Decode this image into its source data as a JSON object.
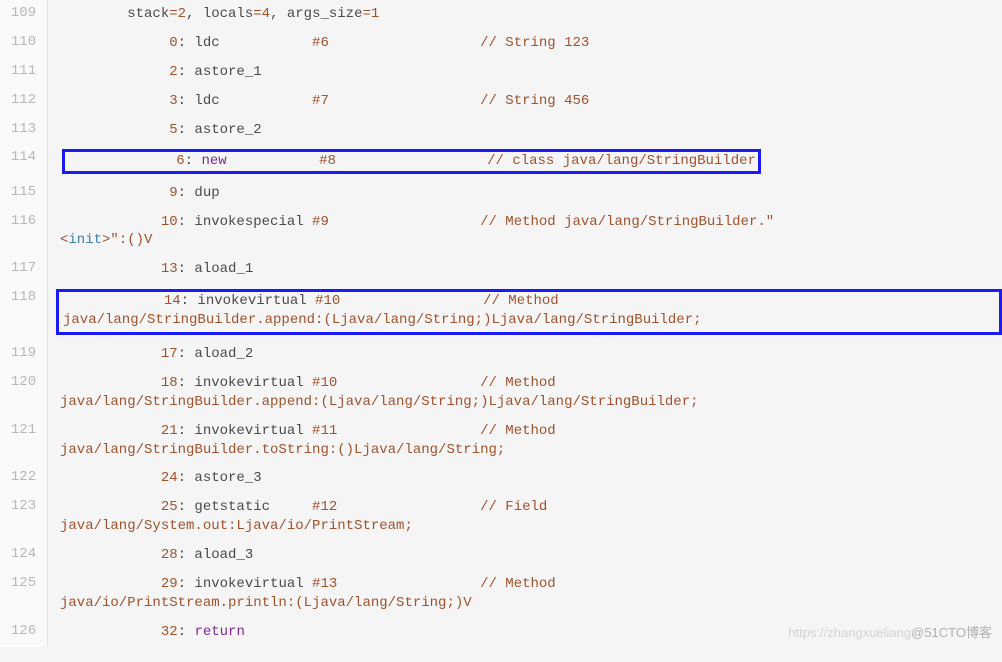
{
  "watermark": {
    "faint": "https://zhangxueliang",
    "dark": "@51CTO博客"
  },
  "lines": [
    {
      "ln": "109",
      "segs": [
        {
          "t": "        stack",
          "c": "c-dark"
        },
        {
          "t": "=",
          "c": "c-orange"
        },
        {
          "t": "2",
          "c": "c-orange"
        },
        {
          "t": ", locals",
          "c": "c-dark"
        },
        {
          "t": "=",
          "c": "c-orange"
        },
        {
          "t": "4",
          "c": "c-orange"
        },
        {
          "t": ", args_size",
          "c": "c-dark"
        },
        {
          "t": "=",
          "c": "c-orange"
        },
        {
          "t": "1",
          "c": "c-orange"
        }
      ]
    },
    {
      "ln": "110",
      "segs": [
        {
          "t": "             0",
          "c": "c-orange"
        },
        {
          "t": ": ldc           ",
          "c": "c-dark"
        },
        {
          "t": "#6",
          "c": "c-orange"
        },
        {
          "t": "                  ",
          "c": "c-dark"
        },
        {
          "t": "// String 123",
          "c": "c-orange"
        }
      ]
    },
    {
      "ln": "111",
      "segs": [
        {
          "t": "             2",
          "c": "c-orange"
        },
        {
          "t": ": astore_1",
          "c": "c-dark"
        }
      ]
    },
    {
      "ln": "112",
      "segs": [
        {
          "t": "             3",
          "c": "c-orange"
        },
        {
          "t": ": ldc           ",
          "c": "c-dark"
        },
        {
          "t": "#7",
          "c": "c-orange"
        },
        {
          "t": "                  ",
          "c": "c-dark"
        },
        {
          "t": "// String 456",
          "c": "c-orange"
        }
      ]
    },
    {
      "ln": "113",
      "segs": [
        {
          "t": "             5",
          "c": "c-orange"
        },
        {
          "t": ": astore_2",
          "c": "c-dark"
        }
      ]
    },
    {
      "ln": "114",
      "hl": "inline",
      "segs": [
        {
          "t": "             6",
          "c": "c-orange"
        },
        {
          "t": ": ",
          "c": "c-dark"
        },
        {
          "t": "new",
          "c": "c-purple"
        },
        {
          "t": "           ",
          "c": "c-dark"
        },
        {
          "t": "#8",
          "c": "c-orange"
        },
        {
          "t": "                  ",
          "c": "c-dark"
        },
        {
          "t": "// class java/lang/StringBuilder",
          "c": "c-orange"
        }
      ]
    },
    {
      "ln": "115",
      "segs": [
        {
          "t": "             9",
          "c": "c-orange"
        },
        {
          "t": ": dup",
          "c": "c-dark"
        }
      ]
    },
    {
      "ln": "116",
      "segs": [
        {
          "t": "            10",
          "c": "c-orange"
        },
        {
          "t": ": invokespecial ",
          "c": "c-dark"
        },
        {
          "t": "#9",
          "c": "c-orange"
        },
        {
          "t": "                  ",
          "c": "c-dark"
        },
        {
          "t": "// Method java/lang/StringBuilder.\"",
          "c": "c-orange"
        }
      ],
      "wrap": [
        {
          "t": "<",
          "c": "c-orange"
        },
        {
          "t": "init",
          "c": "c-blue"
        },
        {
          "t": ">\":()V",
          "c": "c-orange"
        }
      ]
    },
    {
      "ln": "117",
      "segs": [
        {
          "t": "            13",
          "c": "c-orange"
        },
        {
          "t": ": aload_1",
          "c": "c-dark"
        }
      ]
    },
    {
      "ln": "118",
      "hl": "block",
      "segs": [
        {
          "t": "            14",
          "c": "c-orange"
        },
        {
          "t": ": invokevirtual ",
          "c": "c-dark"
        },
        {
          "t": "#10",
          "c": "c-orange"
        },
        {
          "t": "                 ",
          "c": "c-dark"
        },
        {
          "t": "// Method ",
          "c": "c-orange"
        }
      ],
      "wrap": [
        {
          "t": "java/lang/StringBuilder.append:(Ljava/lang/String;)Ljava/lang/StringBuilder;",
          "c": "c-orange"
        }
      ]
    },
    {
      "ln": "119",
      "segs": [
        {
          "t": "            17",
          "c": "c-orange"
        },
        {
          "t": ": aload_2",
          "c": "c-dark"
        }
      ]
    },
    {
      "ln": "120",
      "segs": [
        {
          "t": "            18",
          "c": "c-orange"
        },
        {
          "t": ": invokevirtual ",
          "c": "c-dark"
        },
        {
          "t": "#10",
          "c": "c-orange"
        },
        {
          "t": "                 ",
          "c": "c-dark"
        },
        {
          "t": "// Method ",
          "c": "c-orange"
        }
      ],
      "wrap": [
        {
          "t": "java/lang/StringBuilder.append:(Ljava/lang/String;)Ljava/lang/StringBuilder;",
          "c": "c-orange"
        }
      ]
    },
    {
      "ln": "121",
      "segs": [
        {
          "t": "            21",
          "c": "c-orange"
        },
        {
          "t": ": invokevirtual ",
          "c": "c-dark"
        },
        {
          "t": "#11",
          "c": "c-orange"
        },
        {
          "t": "                 ",
          "c": "c-dark"
        },
        {
          "t": "// Method ",
          "c": "c-orange"
        }
      ],
      "wrap": [
        {
          "t": "java/lang/StringBuilder.toString:()Ljava/lang/String;",
          "c": "c-orange"
        }
      ]
    },
    {
      "ln": "122",
      "segs": [
        {
          "t": "            24",
          "c": "c-orange"
        },
        {
          "t": ": astore_3",
          "c": "c-dark"
        }
      ]
    },
    {
      "ln": "123",
      "segs": [
        {
          "t": "            25",
          "c": "c-orange"
        },
        {
          "t": ": getstatic     ",
          "c": "c-dark"
        },
        {
          "t": "#12",
          "c": "c-orange"
        },
        {
          "t": "                 ",
          "c": "c-dark"
        },
        {
          "t": "// Field ",
          "c": "c-orange"
        }
      ],
      "wrap": [
        {
          "t": "java/lang/System.out:Ljava/io/PrintStream;",
          "c": "c-orange"
        }
      ]
    },
    {
      "ln": "124",
      "segs": [
        {
          "t": "            28",
          "c": "c-orange"
        },
        {
          "t": ": aload_3",
          "c": "c-dark"
        }
      ]
    },
    {
      "ln": "125",
      "segs": [
        {
          "t": "            29",
          "c": "c-orange"
        },
        {
          "t": ": invokevirtual ",
          "c": "c-dark"
        },
        {
          "t": "#13",
          "c": "c-orange"
        },
        {
          "t": "                 ",
          "c": "c-dark"
        },
        {
          "t": "// Method ",
          "c": "c-orange"
        }
      ],
      "wrap": [
        {
          "t": "java/io/PrintStream.println:(Ljava/lang/String;)V",
          "c": "c-orange"
        }
      ]
    },
    {
      "ln": "126",
      "segs": [
        {
          "t": "            32",
          "c": "c-orange"
        },
        {
          "t": ": ",
          "c": "c-dark"
        },
        {
          "t": "return",
          "c": "c-purple"
        }
      ]
    }
  ]
}
